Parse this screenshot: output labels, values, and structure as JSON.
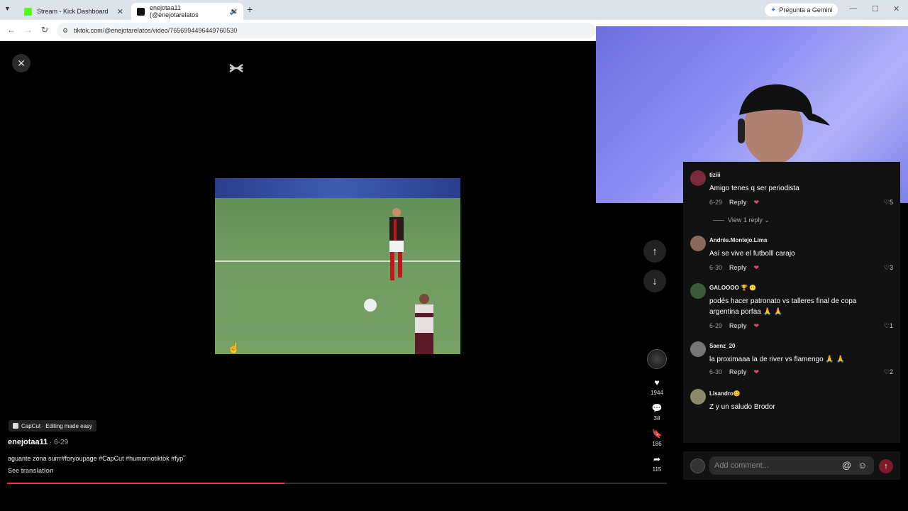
{
  "browser": {
    "tabs": [
      {
        "title": "Stream - Kick Dashboard",
        "favicon_color": "#53fc18"
      },
      {
        "title": "enejotaa11 (@enejotarelatos",
        "favicon_color": "#111111"
      }
    ],
    "gemini_label": "Pregunta a Gemini",
    "url": "tiktok.com/@enejotarelatos/video/7656994496449760530"
  },
  "video": {
    "author": "enejotaa11",
    "date": " · 6-29",
    "capcut_tag": "CapCut · Editing made easy",
    "caption": "aguante zona surrr#foryoupage #CapCut #humornotiktok #fyp˚",
    "see_translation": "See translation",
    "progress": 0.42,
    "counts": {
      "likes": "1944",
      "comments": "38",
      "saves": "186",
      "shares": "115"
    }
  },
  "comments": [
    {
      "name": "tiziii",
      "text": "Amigo tenes q ser periodista",
      "date": "6-29",
      "reply": "Reply",
      "likes": "5",
      "avatar_color": "#7a2b3a"
    },
    {
      "name": "Andrés.Montejo.Lima",
      "text": "Así se vive el futbolll carajo",
      "date": "6-30",
      "reply": "Reply",
      "likes": "3",
      "avatar_color": "#8a6a5a"
    },
    {
      "name": "GALOOOO 🏆 😶",
      "text": "podés hacer patronato vs talleres final de copa argentina porfaa 🙏 🙏",
      "date": "6-29",
      "reply": "Reply",
      "likes": "1",
      "avatar_color": "#3a5a3a"
    },
    {
      "name": "Saenz_20",
      "text": "la proximaaa la de river vs flamengo 🙏 🙏",
      "date": "6-30",
      "reply": "Reply",
      "likes": "2",
      "avatar_color": "#777777"
    },
    {
      "name": "Lisandro😊",
      "text": "Z y un saludo Brodor",
      "date": "",
      "reply": "",
      "likes": "",
      "avatar_color": "#8a8a6a"
    }
  ],
  "view_reply": "View 1 reply",
  "add_comment_placeholder": "Add comment...",
  "accent_color": "#fe2c55"
}
